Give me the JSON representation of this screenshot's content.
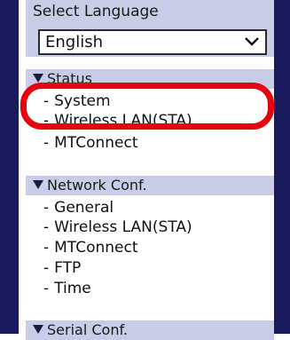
{
  "language": {
    "label": "Select Language",
    "selected": "English"
  },
  "status": {
    "header": "Status",
    "items": [
      "System",
      "Wireless LAN(STA)",
      "MTConnect"
    ]
  },
  "network": {
    "header": "Network Conf.",
    "items": [
      "General",
      "Wireless LAN(STA)",
      "MTConnect",
      "FTP",
      "Time"
    ]
  },
  "serial": {
    "header": "Serial Conf."
  },
  "icons": {
    "dropdown": "chevron-down-icon",
    "expand": "triangle-down-icon"
  },
  "colors": {
    "frame": "#1a1a5e",
    "section_bg": "#c8cce6",
    "highlight": "#e60012"
  }
}
